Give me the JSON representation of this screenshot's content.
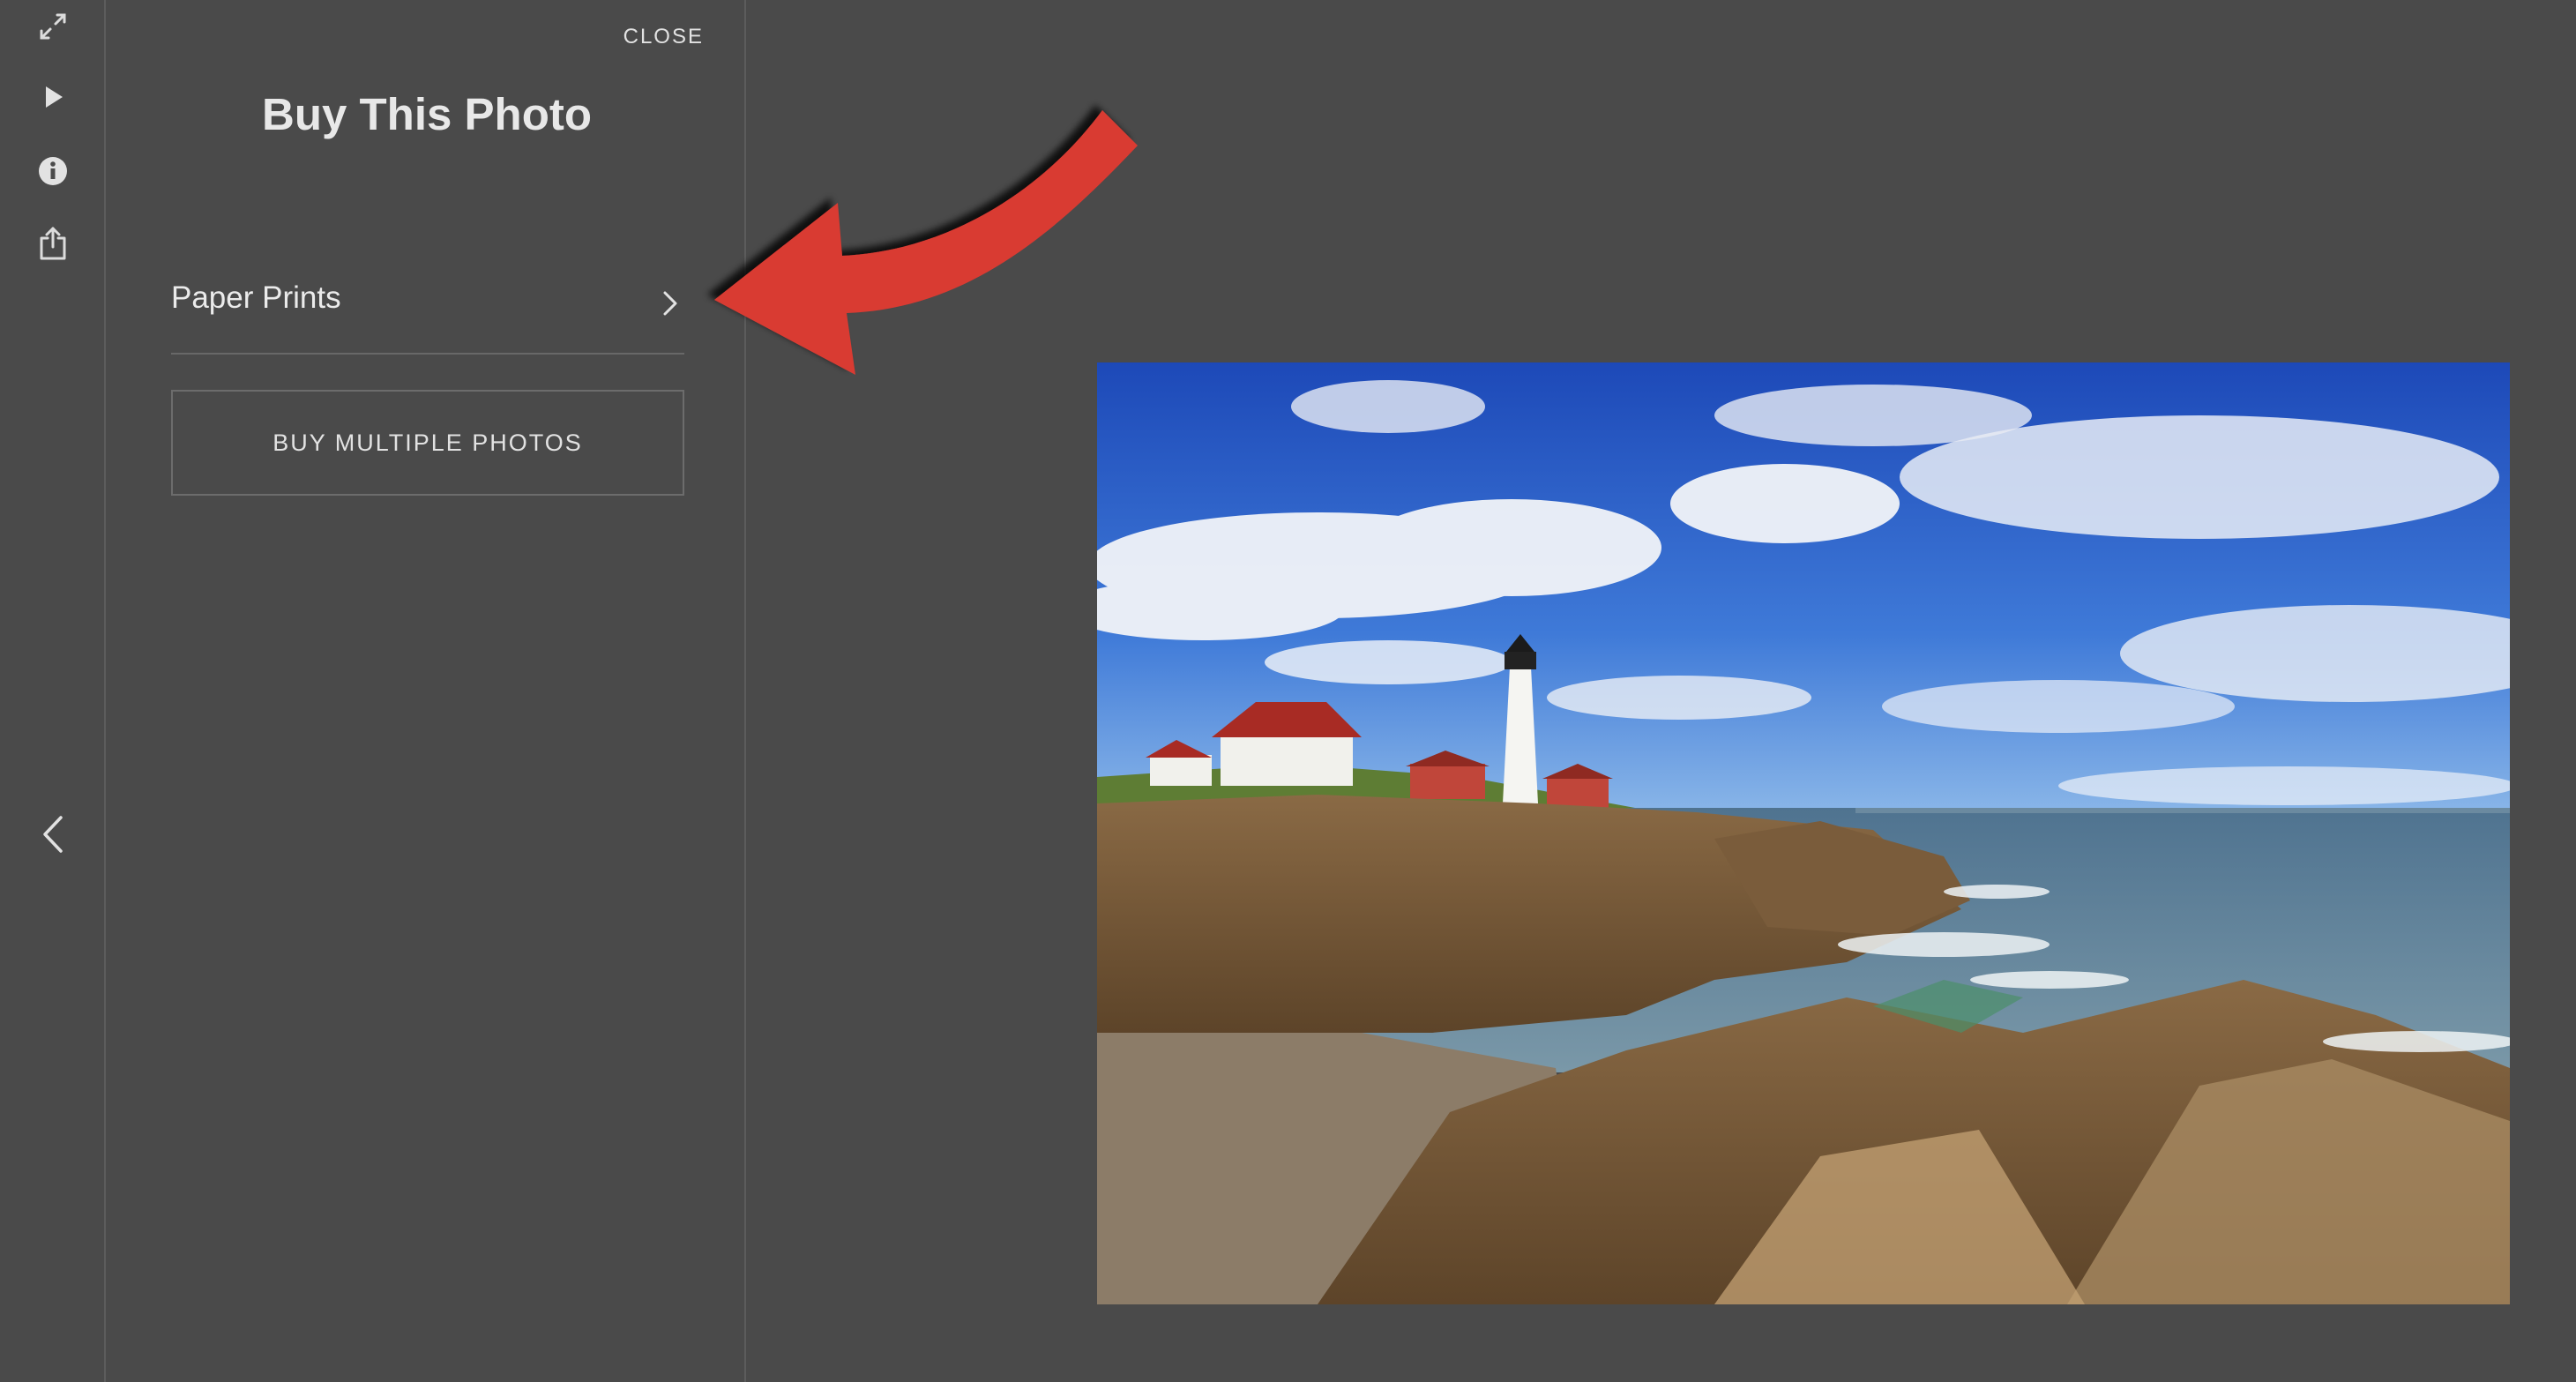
{
  "rail": {
    "buttons": [
      {
        "name": "fullscreen-icon"
      },
      {
        "name": "play-icon"
      },
      {
        "name": "info-icon"
      },
      {
        "name": "share-icon"
      },
      {
        "name": "chevron-left-icon"
      }
    ]
  },
  "panel": {
    "close_label": "CLOSE",
    "title": "Buy This Photo",
    "option_label": "Paper Prints",
    "multi_button_label": "BUY MULTIPLE PHOTOS"
  },
  "annotation": {
    "arrow_color": "#d93a33"
  },
  "photo": {
    "subject": "lighthouse-coastline-photo"
  },
  "colors": {
    "background": "#4a4a4a",
    "divider": "#5c5c5c",
    "text": "#e8e8e8"
  }
}
